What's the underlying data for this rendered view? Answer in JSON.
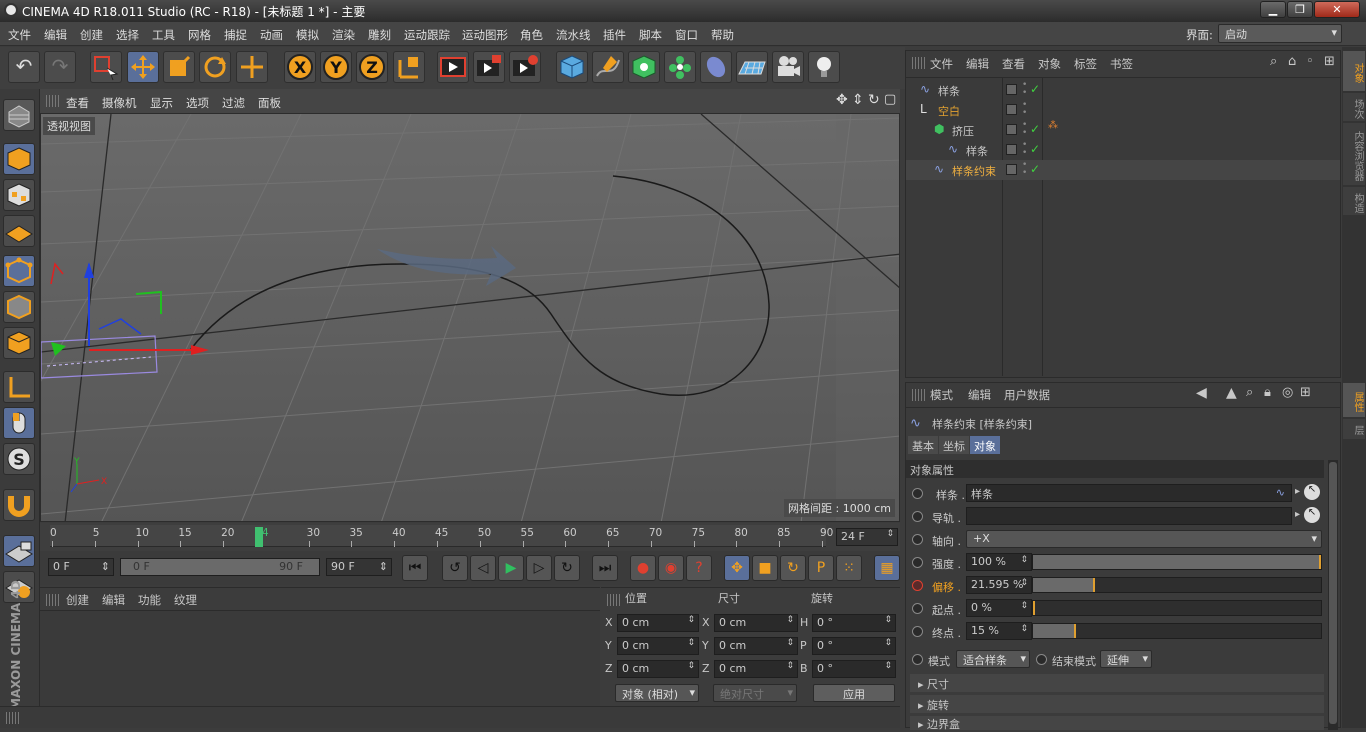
{
  "window": {
    "title": "CINEMA 4D R18.011 Studio (RC - R18) - [未标题 1 *] - 主要",
    "layout_label": "界面:",
    "layout_value": "启动"
  },
  "menu": [
    "文件",
    "编辑",
    "创建",
    "选择",
    "工具",
    "网格",
    "捕捉",
    "动画",
    "模拟",
    "渲染",
    "雕刻",
    "运动跟踪",
    "运动图形",
    "角色",
    "流水线",
    "插件",
    "脚本",
    "窗口",
    "帮助"
  ],
  "toolbar_axes": [
    "X",
    "Y",
    "Z"
  ],
  "viewport": {
    "menu": [
      "查看",
      "摄像机",
      "显示",
      "选项",
      "过滤",
      "面板"
    ],
    "label": "透视视图",
    "grid_spacing": "网格间距 : 1000 cm"
  },
  "timeline": {
    "ticks": [
      "0",
      "5",
      "10",
      "15",
      "20",
      "24",
      "30",
      "35",
      "40",
      "45",
      "50",
      "55",
      "60",
      "65",
      "70",
      "75",
      "80",
      "85",
      "90"
    ],
    "current_frame": "24 F",
    "start": "0 F",
    "range_start": "0 F",
    "range_end": "90 F",
    "end": "90 F"
  },
  "material_menu": [
    "创建",
    "编辑",
    "功能",
    "纹理"
  ],
  "coords": {
    "headers": [
      "位置",
      "尺寸",
      "旋转"
    ],
    "rows": [
      {
        "a": "X",
        "pos": "0 cm",
        "b": "X",
        "size": "0 cm",
        "c": "H",
        "rot": "0 °"
      },
      {
        "a": "Y",
        "pos": "0 cm",
        "b": "Y",
        "size": "0 cm",
        "c": "P",
        "rot": "0 °"
      },
      {
        "a": "Z",
        "pos": "0 cm",
        "b": "Z",
        "size": "0 cm",
        "c": "B",
        "rot": "0 °"
      }
    ],
    "mode": "对象 (相对)",
    "size_mode": "绝对尺寸",
    "apply": "应用"
  },
  "object_manager": {
    "menu": [
      "文件",
      "编辑",
      "查看",
      "对象",
      "标签",
      "书签"
    ],
    "objects": [
      {
        "name": "样条",
        "indent": 0,
        "color": "#c8c8c8"
      },
      {
        "name": "空白",
        "indent": 0,
        "color": "#e0a030"
      },
      {
        "name": "挤压",
        "indent": 1,
        "color": "#c8c8c8"
      },
      {
        "name": "样条",
        "indent": 2,
        "color": "#c8c8c8"
      },
      {
        "name": "样条约束",
        "indent": 1,
        "color": "#f0b040"
      }
    ]
  },
  "attribute_manager": {
    "menu": [
      "模式",
      "编辑",
      "用户数据"
    ],
    "object_title": "样条约束 [样条约束]",
    "tabs": [
      "基本",
      "坐标",
      "对象"
    ],
    "section": "对象属性",
    "fields": [
      {
        "label": "样条 .",
        "value": "样条"
      },
      {
        "label": "导轨 .",
        "value": ""
      },
      {
        "label": "轴向 .",
        "value": "+X"
      },
      {
        "label": "强度 .",
        "value": "100 %",
        "fraction": 1.0
      },
      {
        "label": "偏移 .",
        "value": "21.595 %",
        "fraction": 0.216
      },
      {
        "label": "起点 .",
        "value": "0 %",
        "fraction": 0.0
      },
      {
        "label": "终点 .",
        "value": "15 %",
        "fraction": 0.15
      }
    ],
    "mode_label": "模式",
    "mode_value": "适合样条",
    "end_mode_label": "结束模式",
    "end_mode_value": "延伸",
    "sections": [
      "尺寸",
      "旋转",
      "边界盒"
    ]
  },
  "right_tabs": [
    "对象",
    "场次",
    "内容浏览器",
    "构造"
  ],
  "right_tabs_lower": [
    "属性",
    "层"
  ],
  "brand": "MAXON CINEMA 4D"
}
